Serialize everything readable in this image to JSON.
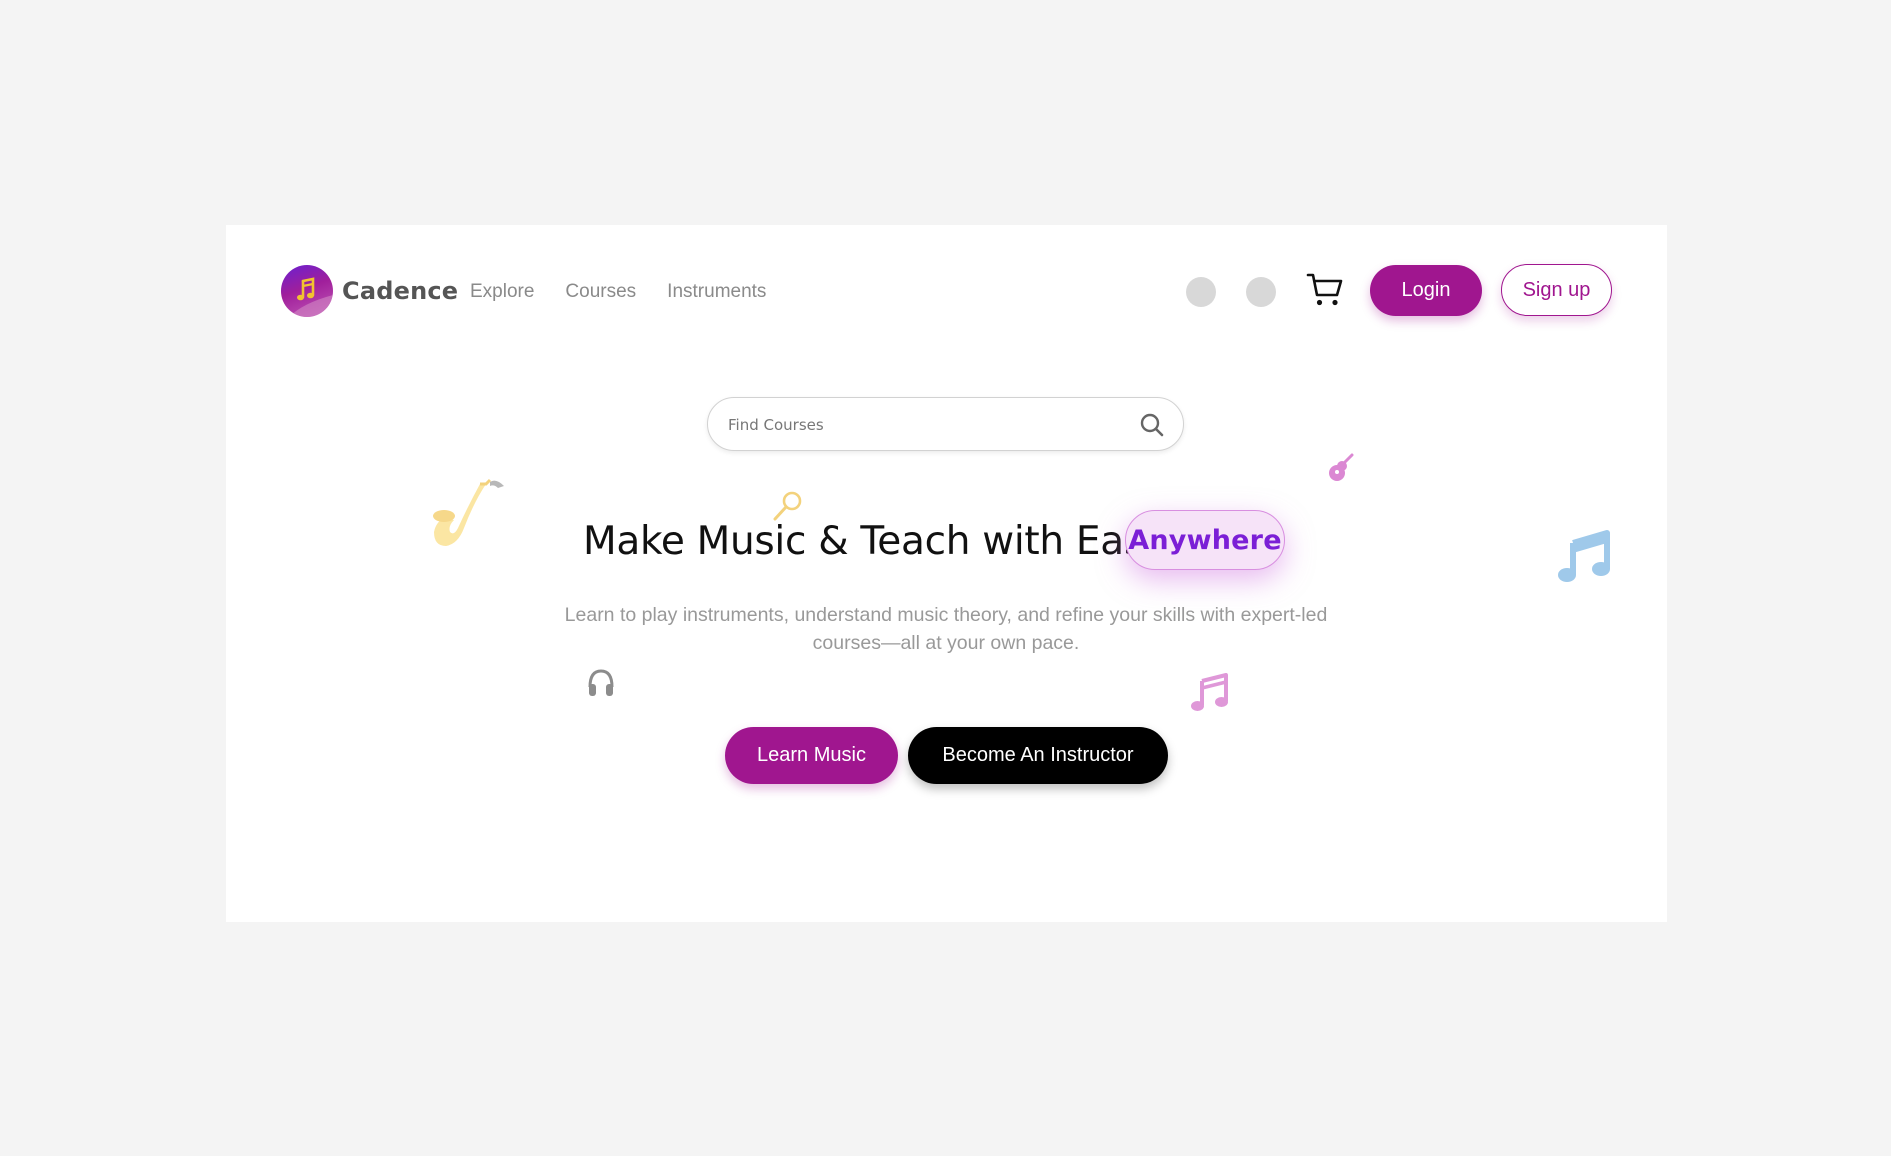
{
  "brand": {
    "name": "Cadence",
    "logo_icon": "music-note-icon"
  },
  "nav": {
    "links": [
      {
        "label": "Explore"
      },
      {
        "label": "Courses"
      },
      {
        "label": "Instruments"
      }
    ],
    "cart_icon": "cart-icon",
    "login_label": "Login",
    "signup_label": "Sign up"
  },
  "search": {
    "placeholder": "Find Courses",
    "value": "",
    "icon": "search-icon"
  },
  "hero": {
    "headline": "Make Music & Teach with Ease",
    "highlight": "Anywhere",
    "subtitle": "Learn to play instruments, understand music theory, and refine your skills with expert-led courses—all at your own pace.",
    "primary_cta": "Learn Music",
    "secondary_cta": "Become An Instructor"
  },
  "decorations": [
    "saxophone-icon",
    "microphone-icon",
    "guitar-icon",
    "music-notes-icon",
    "headphones-icon",
    "music-notes-icon"
  ],
  "colors": {
    "page_bg": "#f4f4f4",
    "card_bg": "#ffffff",
    "primary": "#a0168f",
    "highlight_text": "#7b1fd6",
    "highlight_bg": "#f6e3f8",
    "dark": "#000000",
    "muted_text": "#999999"
  }
}
